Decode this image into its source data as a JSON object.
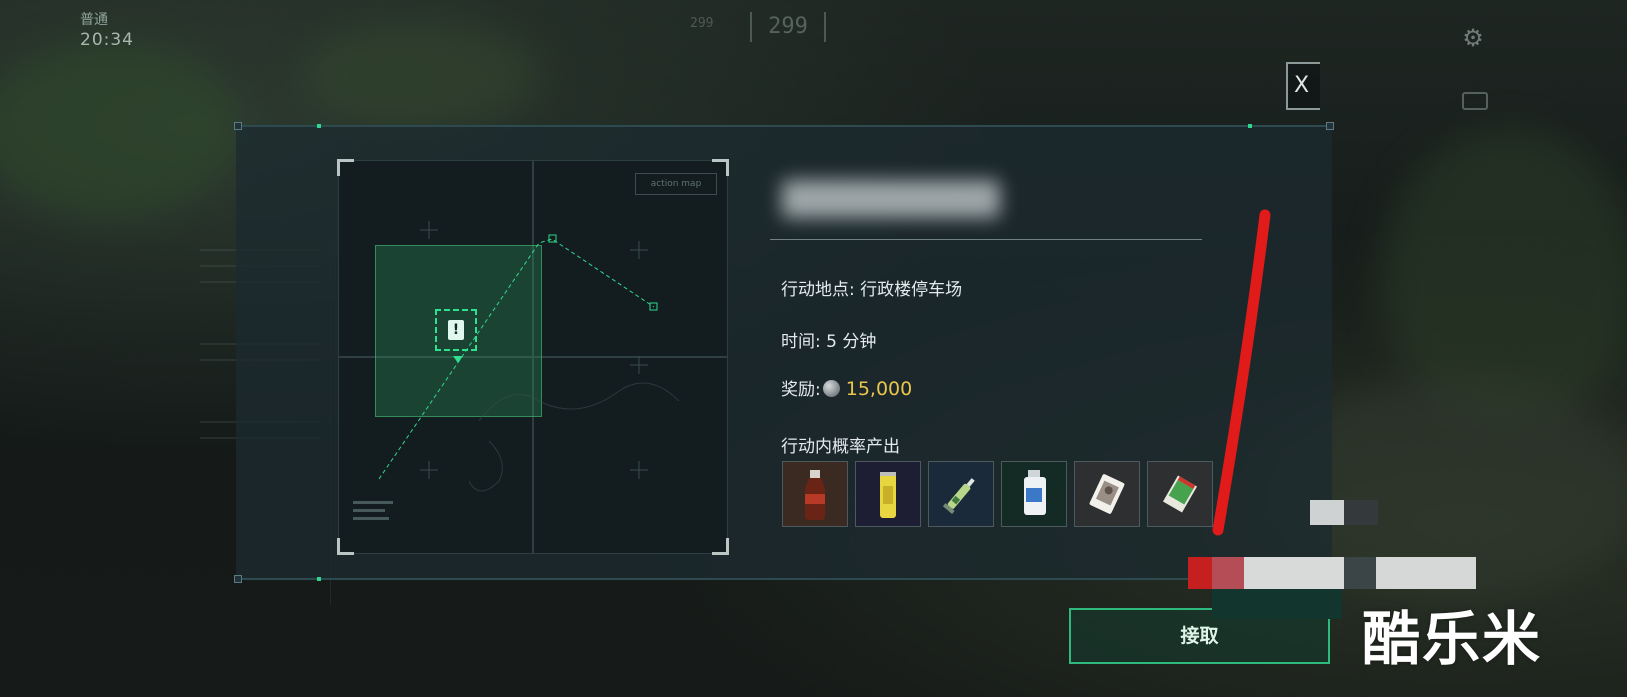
{
  "hud": {
    "mode_label": "普通",
    "clock": "20:34",
    "counter_main": "299",
    "counter_small": "299"
  },
  "close_button": {
    "label": "X"
  },
  "map": {
    "tag_label": "action map",
    "marker_symbol": "!"
  },
  "mission": {
    "location_label": "行动地点:",
    "location_value": "行政楼停车场",
    "time_label": "时间:",
    "time_value": "5 分钟",
    "reward_label": "奖励:",
    "reward_value": "15,000",
    "drops_label": "行动内概率产出"
  },
  "loot_items": [
    {
      "icon": "cola-bottle-icon"
    },
    {
      "icon": "energy-can-icon"
    },
    {
      "icon": "syringe-icon"
    },
    {
      "icon": "medicine-bottle-icon"
    },
    {
      "icon": "playing-card-icon"
    },
    {
      "icon": "cigarette-pack-icon"
    }
  ],
  "accept_button": {
    "label": "接取"
  },
  "watermark": {
    "text": "酷乐米"
  },
  "colors": {
    "accent_green": "#2fe08e",
    "reward_gold": "#e9c64b",
    "annotation_red": "#e11a1a"
  }
}
